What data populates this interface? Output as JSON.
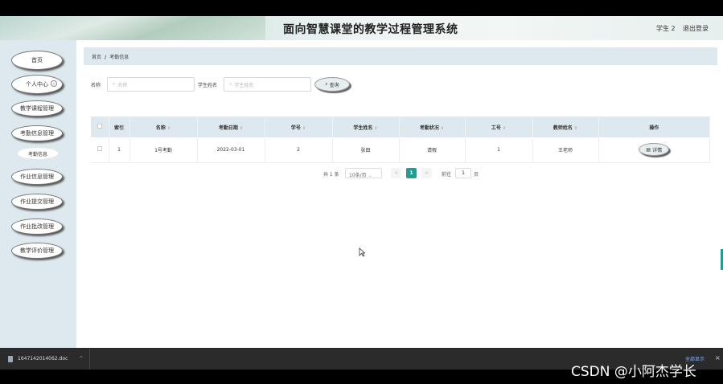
{
  "header": {
    "title": "面向智慧课堂的教学过程管理系统",
    "user": "学生 2",
    "logout": "退出登录"
  },
  "sidebar": {
    "items": [
      {
        "label": "首页"
      },
      {
        "label": "个人中心"
      },
      {
        "label": "教学课程管理"
      },
      {
        "label": "考勤信息管理"
      },
      {
        "label": "考勤信息"
      },
      {
        "label": "作业信息管理"
      },
      {
        "label": "作业提交管理"
      },
      {
        "label": "作业批改管理"
      },
      {
        "label": "教学评价管理"
      }
    ]
  },
  "breadcrumb": {
    "home": "首页",
    "separator": "/",
    "current": "考勤信息"
  },
  "search": {
    "name_label": "名称",
    "name_placeholder": "名称",
    "student_label": "学生姓名",
    "student_placeholder": "学生姓名",
    "button": "查询"
  },
  "table": {
    "headers": [
      "索引",
      "名称",
      "考勤日期",
      "学号",
      "学生姓名",
      "考勤状况",
      "工号",
      "教师姓名",
      "操作"
    ],
    "rows": [
      {
        "index": "1",
        "name": "1号考勤",
        "date": "2022-03-01",
        "student_no": "2",
        "student_name": "张田",
        "status": "请假",
        "job_no": "1",
        "teacher": "王老师",
        "action": "详情"
      }
    ]
  },
  "pagination": {
    "total": "共 1 条",
    "page_size": "10条/页",
    "prev": "<",
    "current": "1",
    "next": ">",
    "goto": "前往",
    "goto_value": "1",
    "page_unit": "页"
  },
  "download_bar": {
    "file": "1647142014062.doc",
    "show_all": "全部显示",
    "close": "×"
  },
  "watermark": "CSDN @小阿杰学长",
  "colors": {
    "accent": "#1aa094",
    "sidebar_bg": "#dde9ee"
  }
}
